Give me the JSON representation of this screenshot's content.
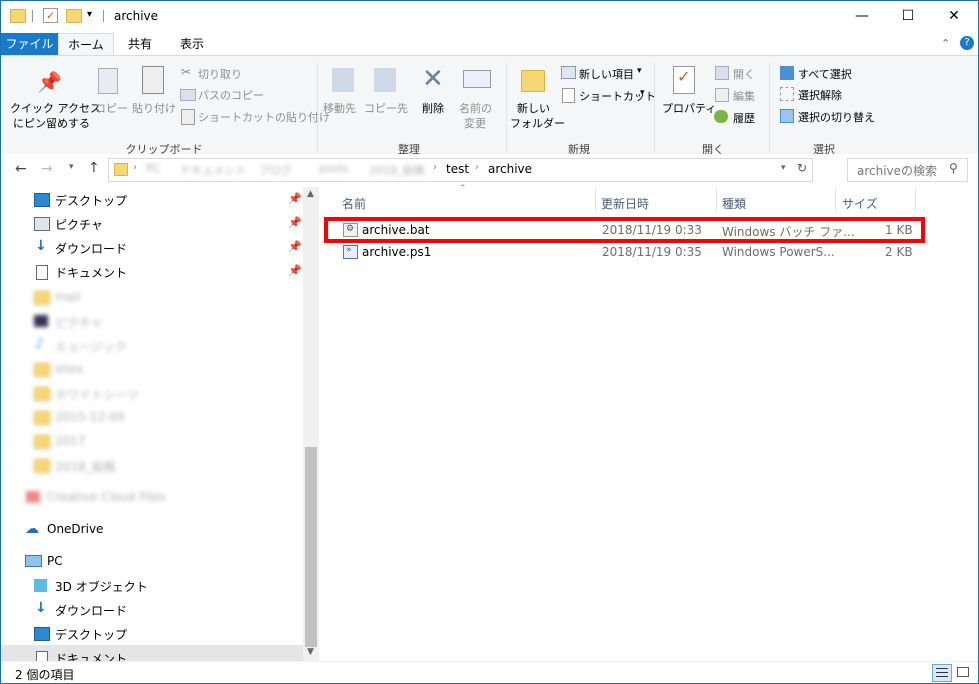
{
  "window": {
    "title": "archive",
    "controls": {
      "minimize": "—",
      "maximize": "☐",
      "close": "✕"
    }
  },
  "tabs": [
    {
      "label": "ファイル"
    },
    {
      "label": "ホーム"
    },
    {
      "label": "共有"
    },
    {
      "label": "表示"
    }
  ],
  "ribbon": {
    "clipboard": {
      "pin_quick_access": "クイック アクセス",
      "pin_quick_access2": "にピン留めする",
      "copy": "コピー",
      "paste": "貼り付け",
      "cut": "切り取り",
      "copy_path": "パスのコピー",
      "paste_shortcut": "ショートカットの貼り付け",
      "group": "クリップボード"
    },
    "organize": {
      "move_to": "移動先",
      "copy_to": "コピー先",
      "delete": "削除",
      "rename1": "名前の",
      "rename2": "変更",
      "group": "整理"
    },
    "new": {
      "new_folder1": "新しい",
      "new_folder2": "フォルダー",
      "new_item": "新しい項目",
      "shortcut": "ショートカット",
      "group": "新規"
    },
    "open": {
      "properties": "プロパティ",
      "open": "開く",
      "edit": "編集",
      "history": "履歴",
      "group": "開く"
    },
    "select": {
      "select_all": "すべて選択",
      "select_none": "選択解除",
      "invert": "選択の切り替え",
      "group": "選択"
    }
  },
  "address": {
    "segments": [
      "PC",
      "ドキュメント",
      "ブログ",
      "posts",
      "2018_投稿",
      "test",
      "archive"
    ],
    "search_placeholder": "archiveの検索"
  },
  "navpane": {
    "quick": [
      {
        "label": "デスクトップ",
        "icon": "desktop-icon",
        "pinned": true
      },
      {
        "label": "ピクチャ",
        "icon": "pictures-icon",
        "pinned": true
      },
      {
        "label": "ダウンロード",
        "icon": "download-icon",
        "pinned": true
      },
      {
        "label": "ドキュメント",
        "icon": "documents-icon",
        "pinned": true
      }
    ],
    "blurred": [
      "mail",
      "ピクチャ",
      "ミュージック",
      "sites",
      "ホワイトシーツ",
      "2015-12-09",
      "2017",
      "2018_投稿",
      "Creative Cloud Files"
    ],
    "onedrive": "OneDrive",
    "pc": "PC",
    "pc_items": [
      {
        "label": "3D オブジェクト",
        "icon": "cube-icon"
      },
      {
        "label": "ダウンロード",
        "icon": "download-icon"
      },
      {
        "label": "デスクトップ",
        "icon": "desktop-icon"
      },
      {
        "label": "ドキュメント",
        "icon": "documents-icon"
      }
    ]
  },
  "columns": {
    "name": "名前",
    "date": "更新日時",
    "type": "種類",
    "size": "サイズ"
  },
  "files": [
    {
      "name": "archive.bat",
      "date": "2018/11/19 0:33",
      "type": "Windows バッチ ファ...",
      "size": "1 KB",
      "icon": "batch-file-icon"
    },
    {
      "name": "archive.ps1",
      "date": "2018/11/19 0:35",
      "type": "Windows PowerS...",
      "size": "2 KB",
      "icon": "powershell-file-icon"
    }
  ],
  "status": {
    "count": "2 個の項目"
  },
  "colors": {
    "accent": "#1979ca",
    "highlight": "#ff0000",
    "folder": "#f7d774"
  }
}
